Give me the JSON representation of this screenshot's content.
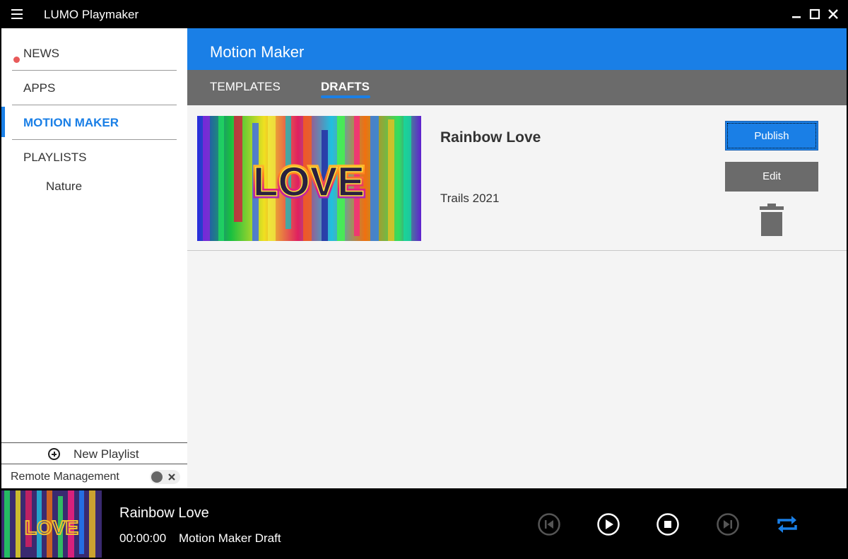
{
  "window": {
    "title": "LUMO Playmaker",
    "menu_icon": "hamburger-icon",
    "controls": [
      "minimize-icon",
      "maximize-icon",
      "close-icon"
    ]
  },
  "sidebar": {
    "items": [
      {
        "label": "NEWS",
        "badge": "notification-dot",
        "badge_color": "#e85a5a"
      },
      {
        "label": "APPS"
      },
      {
        "label": "MOTION MAKER",
        "active": true
      },
      {
        "label": "PLAYLISTS"
      }
    ],
    "playlists": [
      {
        "label": "Nature"
      }
    ],
    "new_playlist_label": "New Playlist",
    "remote_management_label": "Remote Management",
    "remote_management_enabled": false
  },
  "main": {
    "title": "Motion Maker",
    "tabs": [
      {
        "label": "TEMPLATES",
        "active": false
      },
      {
        "label": "DRAFTS",
        "active": true
      }
    ],
    "drafts": [
      {
        "title": "Rainbow Love",
        "subtitle": "Trails 2021",
        "thumbnail_text": "LOVE",
        "publish_label": "Publish",
        "edit_label": "Edit",
        "delete_icon": "trash-icon"
      }
    ]
  },
  "player": {
    "title": "Rainbow Love",
    "time": "00:00:00",
    "source_label": "Motion Maker Draft",
    "thumbnail_text": "LOVE",
    "controls": [
      "skip-previous-icon",
      "play-icon",
      "stop-icon",
      "skip-next-icon",
      "repeat-icon"
    ],
    "repeat_active": true
  },
  "colors": {
    "accent": "#1a7fe6",
    "tab_bar": "#6b6b6b",
    "news_dot": "#e85a5a",
    "player_bg": "#000000"
  }
}
